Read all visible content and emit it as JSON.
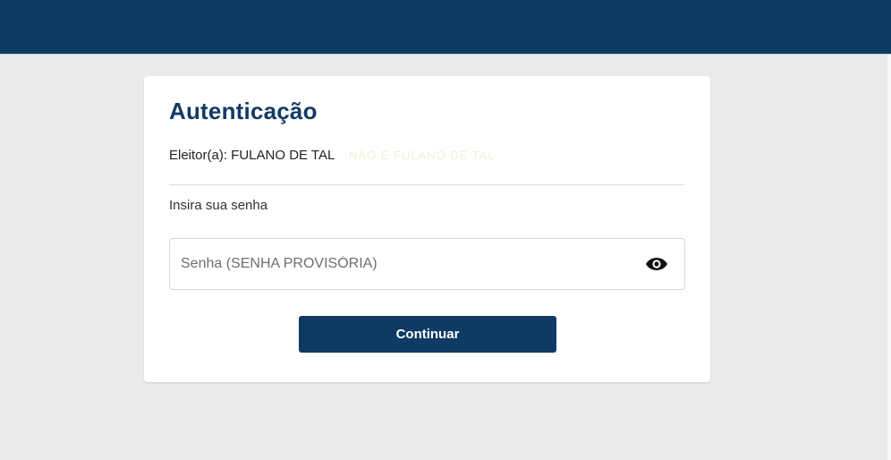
{
  "header": {
    "background_color": "#0f3a63"
  },
  "auth": {
    "title": "Autenticação",
    "voter_label": "Eleitor(a): FULANO DE TAL",
    "voter_faded_text": "NÃO É FULANO DE TAL",
    "instruction": "Insira sua senha",
    "password": {
      "placeholder": "Senha (SENHA PROVISÓRIA)",
      "value": "",
      "toggle_icon": "eye-icon"
    },
    "continue_label": "Continuar"
  },
  "colors": {
    "primary": "#0f3a63",
    "background": "#ebebeb",
    "card": "#ffffff"
  }
}
